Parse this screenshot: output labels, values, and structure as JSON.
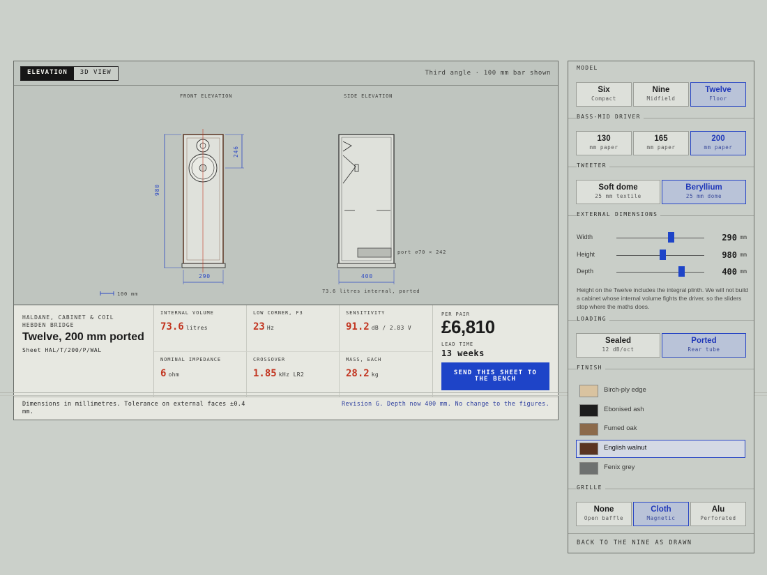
{
  "sheet": {
    "tabs": [
      {
        "label": "ELEVATION",
        "active": true
      },
      {
        "label": "3D VIEW",
        "active": false
      }
    ],
    "view_note": "Third angle · 100 mm bar shown",
    "drawing": {
      "front_label": "FRONT ELEVATION",
      "side_label": "SIDE ELEVATION",
      "dim_height": "980",
      "dim_width": "290",
      "dim_driver": "246",
      "dim_depth": "400",
      "port_note": "port ⌀70 × 242",
      "scale_bar": "100 mm",
      "volume_note": "73.6 litres internal, ported"
    },
    "brand": {
      "maker": "HALDANE, CABINET & COIL",
      "town": "HEBDEN BRIDGE",
      "model": "Twelve, 200 mm ported",
      "sheet_no": "Sheet HAL/T/200/P/WAL"
    },
    "specs": [
      {
        "label": "INTERNAL VOLUME",
        "value": "73.6",
        "unit": "litres"
      },
      {
        "label": "LOW CORNER, F3",
        "value": "23",
        "unit": "Hz"
      },
      {
        "label": "SENSITIVITY",
        "value": "91.2",
        "unit": "dB / 2.83 V"
      },
      {
        "label": "NOMINAL IMPEDANCE",
        "value": "6",
        "unit": "ohm"
      },
      {
        "label": "CROSSOVER",
        "value": "1.85",
        "unit": "kHz LR2"
      },
      {
        "label": "MASS, EACH",
        "value": "28.2",
        "unit": "kg"
      }
    ],
    "price": {
      "label": "PER PAIR",
      "amount": "£6,810",
      "lead_label": "LEAD TIME",
      "lead_value": "13 weeks",
      "cta": "SEND THIS SHEET TO THE BENCH"
    },
    "footer": {
      "left": "Dimensions in millimetres. Tolerance on external faces ±0.4 mm.",
      "right": "Revision G. Depth now 400 mm. No change to the figures."
    }
  },
  "panel": {
    "model": {
      "title": "MODEL",
      "options": [
        {
          "label": "Six",
          "sub": "Compact"
        },
        {
          "label": "Nine",
          "sub": "Midfield"
        },
        {
          "label": "Twelve",
          "sub": "Floor",
          "selected": true
        }
      ]
    },
    "driver": {
      "title": "BASS-MID DRIVER",
      "options": [
        {
          "label": "130",
          "sub": "mm paper"
        },
        {
          "label": "165",
          "sub": "mm paper"
        },
        {
          "label": "200",
          "sub": "mm paper",
          "selected": true
        }
      ]
    },
    "tweeter": {
      "title": "TWEETER",
      "options": [
        {
          "label": "Soft dome",
          "sub": "25 mm textile"
        },
        {
          "label": "Beryllium",
          "sub": "25 mm dome",
          "selected": true
        }
      ]
    },
    "dimensions": {
      "title": "EXTERNAL DIMENSIONS",
      "rows": [
        {
          "label": "Width",
          "value": "290",
          "unit": "mm",
          "level": 0.62
        },
        {
          "label": "Height",
          "value": "980",
          "unit": "mm",
          "level": 0.52
        },
        {
          "label": "Depth",
          "value": "400",
          "unit": "mm",
          "level": 0.74
        }
      ],
      "note": "Height on the Twelve includes the integral plinth. We will not build a cabinet whose internal volume fights the driver, so the sliders stop where the maths does."
    },
    "loading": {
      "title": "LOADING",
      "options": [
        {
          "label": "Sealed",
          "sub": "12 dB/oct"
        },
        {
          "label": "Ported",
          "sub": "Rear tube",
          "selected": true
        }
      ]
    },
    "finish": {
      "title": "FINISH",
      "items": [
        {
          "name": "Birch-ply edge",
          "swatch": "#d9c3a0"
        },
        {
          "name": "Ebonised ash",
          "swatch": "#1d1d1d"
        },
        {
          "name": "Fumed oak",
          "swatch": "#8c6a4a"
        },
        {
          "name": "English walnut",
          "swatch": "#5a3422",
          "selected": true
        },
        {
          "name": "Fenix grey",
          "swatch": "#6e7170"
        }
      ]
    },
    "grille": {
      "title": "GRILLE",
      "options": [
        {
          "label": "None",
          "sub": "Open baffle"
        },
        {
          "label": "Cloth",
          "sub": "Magnetic",
          "selected": true
        },
        {
          "label": "Alu",
          "sub": "Perforated"
        }
      ]
    },
    "back_link": "BACK TO THE NINE AS DRAWN"
  },
  "colors": {
    "accent": "#1e44c8",
    "figure": "#c2341f",
    "walnut": "#5a3422"
  }
}
